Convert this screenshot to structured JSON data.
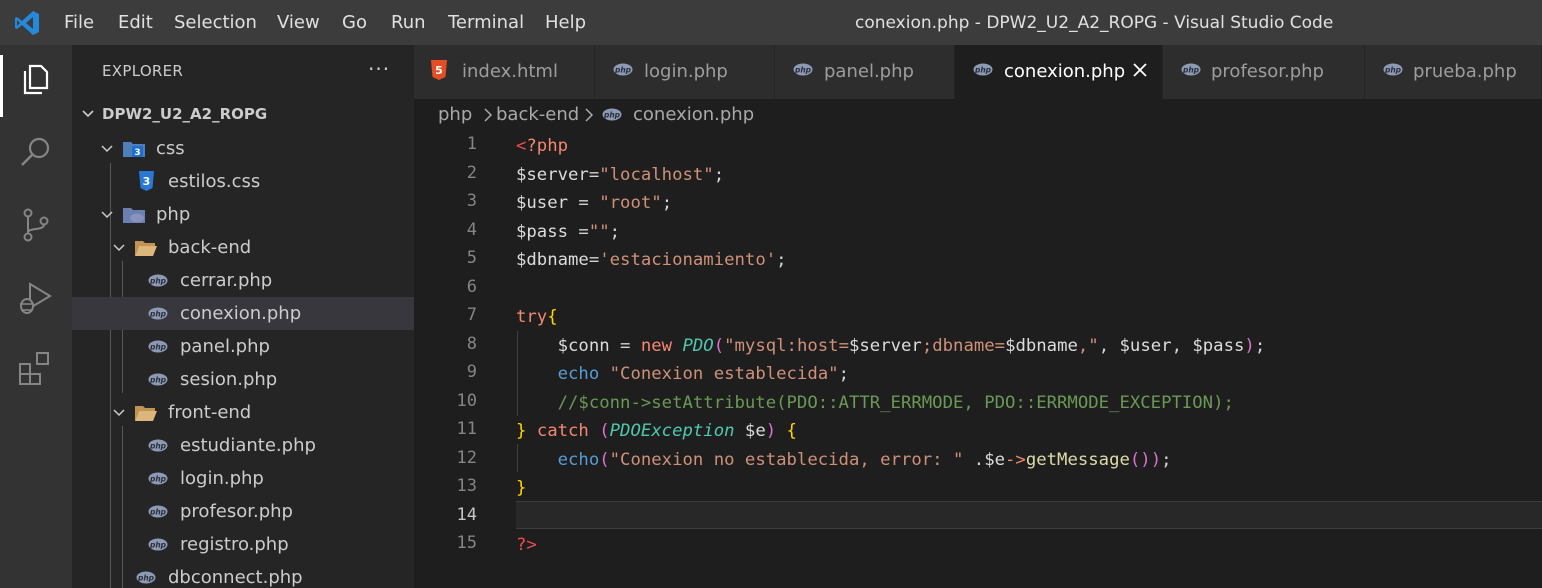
{
  "menu": [
    "File",
    "Edit",
    "Selection",
    "View",
    "Go",
    "Run",
    "Terminal",
    "Help"
  ],
  "window_title": "conexion.php - DPW2_U2_A2_ROPG - Visual Studio Code",
  "activity_bar": [
    "explorer-icon",
    "search-icon",
    "source-control-icon",
    "run-debug-icon",
    "extensions-icon"
  ],
  "sidebar": {
    "title": "EXPLORER",
    "more": "···",
    "root": "DPW2_U2_A2_ROPG",
    "tree": [
      {
        "label": "css",
        "kind": "folder",
        "expanded": true
      },
      {
        "label": "estilos.css",
        "kind": "css"
      },
      {
        "label": "php",
        "kind": "folder",
        "expanded": true
      },
      {
        "label": "back-end",
        "kind": "folder",
        "expanded": true
      },
      {
        "label": "cerrar.php",
        "kind": "php"
      },
      {
        "label": "conexion.php",
        "kind": "php",
        "selected": true
      },
      {
        "label": "panel.php",
        "kind": "php"
      },
      {
        "label": "sesion.php",
        "kind": "php"
      },
      {
        "label": "front-end",
        "kind": "folder",
        "expanded": true
      },
      {
        "label": "estudiante.php",
        "kind": "php"
      },
      {
        "label": "login.php",
        "kind": "php"
      },
      {
        "label": "profesor.php",
        "kind": "php"
      },
      {
        "label": "registro.php",
        "kind": "php"
      },
      {
        "label": "dbconnect.php",
        "kind": "php"
      }
    ]
  },
  "tabs": [
    {
      "label": "index.html",
      "icon": "html5-icon"
    },
    {
      "label": "login.php",
      "icon": "php-icon"
    },
    {
      "label": "panel.php",
      "icon": "php-icon"
    },
    {
      "label": "conexion.php",
      "icon": "php-icon",
      "active": true
    },
    {
      "label": "profesor.php",
      "icon": "php-icon"
    },
    {
      "label": "prueba.php",
      "icon": "php-icon"
    }
  ],
  "breadcrumb": [
    "php",
    "back-end",
    "conexion.php"
  ],
  "editor": {
    "current_line": 14,
    "line_numbers": [
      "1",
      "2",
      "3",
      "4",
      "5",
      "6",
      "7",
      "8",
      "9",
      "10",
      "11",
      "12",
      "13",
      "14",
      "15"
    ],
    "lines": [
      "<?php",
      "$server=\"localhost\";",
      "$user = \"root\";",
      "$pass =\"\";",
      "$dbname='estacionamiento';",
      "",
      "try{",
      "    $conn = new PDO(\"mysql:host=$server;dbname=$dbname,\", $user, $pass);",
      "    echo \"Conexion establecida\";",
      "    //$conn->setAttribute(PDO::ATTR_ERRMODE, PDO::ERRMODE_EXCEPTION);",
      "} catch (PDOException $e) {",
      "    echo(\"Conexion no establecida, error: \" .$e->getMessage());",
      "}",
      "",
      "?>"
    ]
  },
  "colors": {
    "titlebar": "#3c3c3c",
    "activitybar": "#333333",
    "sidebar": "#252526",
    "editor": "#1e1e1e",
    "selected_row": "#37373d",
    "accent_blue": "#2489db"
  }
}
